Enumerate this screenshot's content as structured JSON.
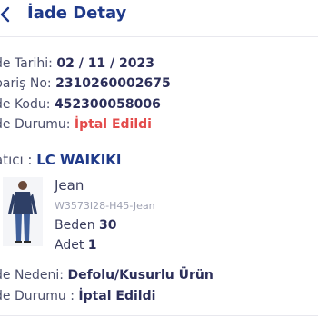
{
  "header": {
    "title": "İade Detay"
  },
  "details": {
    "date_label": "de Tarihi:",
    "date_value": "02 / 11 / 2023",
    "order_label": "pariş No:",
    "order_value": "2310260002675",
    "code_label": "de Kodu:",
    "code_value": "452300058006",
    "status_label": "de Durumu:",
    "status_value": "İptal Edildi"
  },
  "seller": {
    "label": "atıcı : ",
    "name": "LC WAIKIKI"
  },
  "product": {
    "name": "Jean",
    "sku": "W3573I28-H45-Jean",
    "size_label": "Beden",
    "size_value": "30",
    "qty_label": "Adet",
    "qty_value": "1"
  },
  "footer_info": {
    "reason_label": "de Nedeni:",
    "reason_value": "Defolu/Kusurlu Ürün",
    "status_label": "de Durumu : ",
    "status_value": "İptal Edildi"
  },
  "colors": {
    "brand": "#1f3a8a",
    "danger": "#e34b4b",
    "muted": "#9ea1b2"
  },
  "icons": {
    "back": "chevron-left-icon",
    "product": "product-image"
  }
}
